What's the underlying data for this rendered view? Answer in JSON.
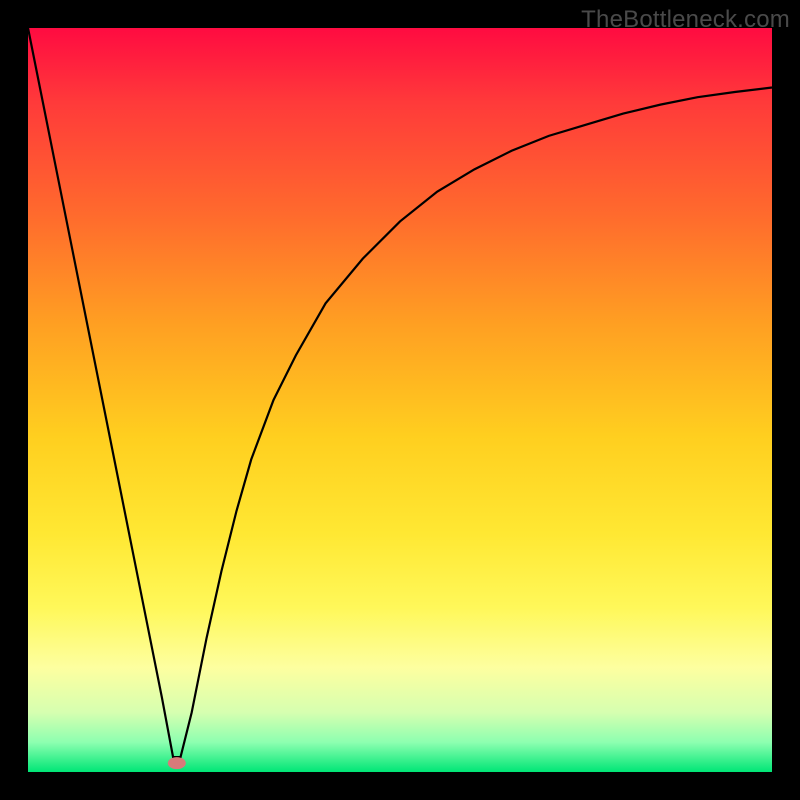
{
  "watermark": "TheBottleneck.com",
  "chart_data": {
    "type": "line",
    "title": "",
    "xlabel": "",
    "ylabel": "",
    "xlim": [
      0,
      100
    ],
    "ylim": [
      0,
      100
    ],
    "grid": false,
    "series": [
      {
        "name": "bottleneck-curve",
        "x": [
          0,
          2,
          4,
          6,
          8,
          10,
          12,
          14,
          16,
          18,
          19.5,
          20.5,
          22,
          24,
          26,
          28,
          30,
          33,
          36,
          40,
          45,
          50,
          55,
          60,
          65,
          70,
          75,
          80,
          85,
          90,
          95,
          100
        ],
        "values": [
          100,
          90,
          80,
          70,
          60,
          50,
          40,
          30,
          20,
          10,
          2,
          2,
          8,
          18,
          27,
          35,
          42,
          50,
          56,
          63,
          69,
          74,
          78,
          81,
          83.5,
          85.5,
          87,
          88.5,
          89.7,
          90.7,
          91.4,
          92
        ]
      }
    ],
    "marker": {
      "x": 20,
      "y": 1.2,
      "shape": "ellipse",
      "color": "#d97a7a"
    },
    "background": "rainbow-vertical-gradient",
    "line_color": "#000000",
    "line_width": 2
  }
}
